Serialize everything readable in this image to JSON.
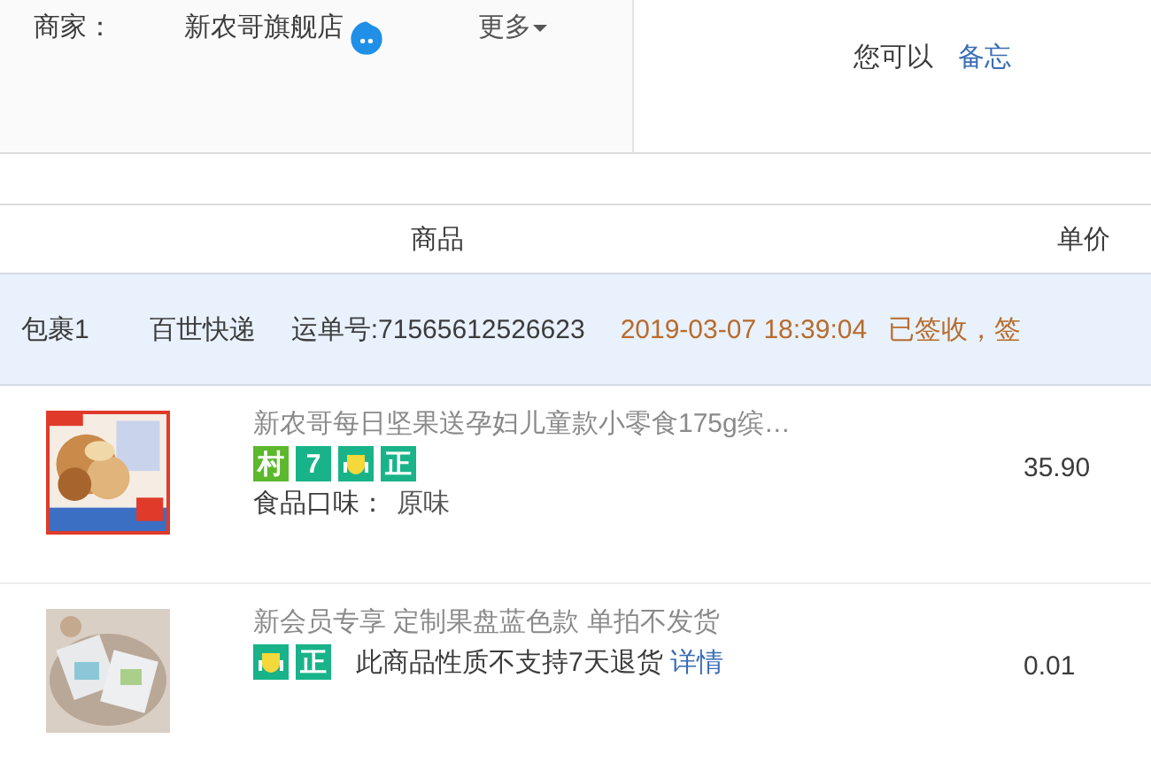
{
  "seller": {
    "label": "商家：",
    "name": "新农哥旗舰店",
    "more": "更多"
  },
  "memo": {
    "text": "您可以",
    "link": "备忘"
  },
  "table": {
    "columns": [
      "商品",
      "单价"
    ]
  },
  "package": {
    "name": "包裹1",
    "carrier": "百世快递",
    "tracking": "运单号:71565612526623",
    "time": "2019-03-07 18:39:04",
    "status": "已签收，签"
  },
  "items": [
    {
      "title": "新农哥每日坚果送孕妇儿童款小零食175g缤…",
      "badges": [
        {
          "kind": "text",
          "label": "村",
          "color": "#5cb82c"
        },
        {
          "kind": "text",
          "label": "7",
          "color": "#19b38a"
        },
        {
          "kind": "icon",
          "color": "#19b38a"
        },
        {
          "kind": "text",
          "label": "正",
          "color": "#19b38a"
        }
      ],
      "note_label": "食品口味：",
      "note_value": "原味",
      "price": "35.90"
    },
    {
      "title": "新会员专享 定制果盘蓝色款 单拍不发货",
      "badges": [
        {
          "kind": "icon",
          "color": "#19b38a"
        },
        {
          "kind": "text",
          "label": "正",
          "color": "#19b38a"
        }
      ],
      "notice": "此商品性质不支持7天退货",
      "notice_link": "详情",
      "price": "0.01"
    }
  ]
}
